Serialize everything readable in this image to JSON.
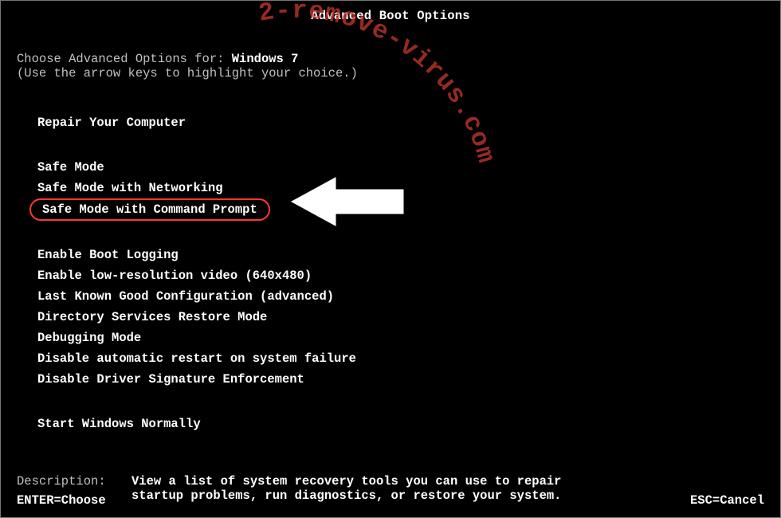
{
  "title": "Advanced Boot Options",
  "choose_prefix": "Choose Advanced Options for: ",
  "os": "Windows 7",
  "hint": "(Use the arrow keys to highlight your choice.)",
  "groups": {
    "repair": "Repair Your Computer",
    "modes": [
      "Safe Mode",
      "Safe Mode with Networking",
      "Safe Mode with Command Prompt"
    ],
    "other": [
      "Enable Boot Logging",
      "Enable low-resolution video (640x480)",
      "Last Known Good Configuration (advanced)",
      "Directory Services Restore Mode",
      "Debugging Mode",
      "Disable automatic restart on system failure",
      "Disable Driver Signature Enforcement"
    ],
    "start": "Start Windows Normally"
  },
  "highlighted_index": 2,
  "description": {
    "label": "Description:",
    "text_line1": "View a list of system recovery tools you can use to repair",
    "text_line2": "startup problems, run diagnostics, or restore your system."
  },
  "footer": {
    "left": "ENTER=Choose",
    "right": "ESC=Cancel"
  },
  "watermark": "2-remove-virus.com"
}
